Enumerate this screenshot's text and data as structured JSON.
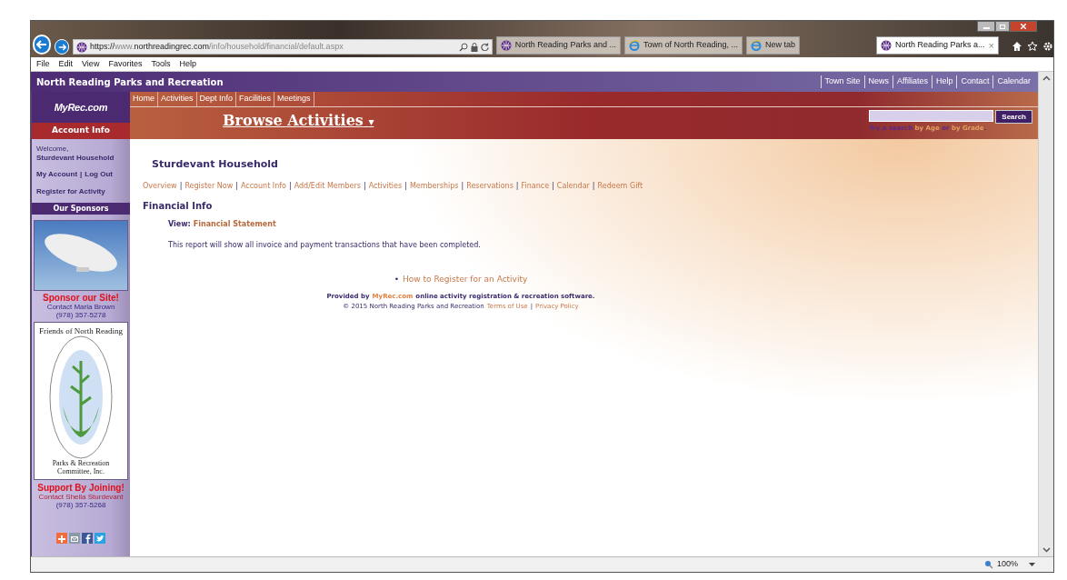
{
  "browser": {
    "address": {
      "scheme": "https://",
      "prefix": "www.",
      "domain": "northreadingrec.com",
      "path": "/info/household/financial/default.aspx"
    },
    "tabs": [
      {
        "title": "North Reading Parks and ...",
        "kind": "site",
        "selected": false
      },
      {
        "title": "Town of North Reading, ...",
        "kind": "ie",
        "selected": false
      },
      {
        "title": "New tab",
        "kind": "ie",
        "selected": false
      },
      {
        "title": "North Reading Parks a...",
        "kind": "site",
        "selected": true
      }
    ],
    "close_glyph": "×",
    "menu": [
      "File",
      "Edit",
      "View",
      "Favorites",
      "Tools",
      "Help"
    ],
    "zoom": "100%"
  },
  "site": {
    "title": "North Reading Parks and Recreation",
    "top_links": [
      "Town Site",
      "News",
      "Affiliates",
      "Help",
      "Contact",
      "Calendar"
    ],
    "nav": [
      "Home",
      "Activities",
      "Dept Info",
      "Facilities",
      "Meetings"
    ],
    "browse": "Browse Activities",
    "browse_caret": "▾",
    "search_button": "Search",
    "search_hint": [
      {
        "text": "Try a search",
        "kind": "plain"
      },
      {
        "text": "by Age",
        "kind": "link"
      },
      {
        "text": "or",
        "kind": "plain"
      },
      {
        "text": "by Grade",
        "kind": "link"
      },
      {
        "text": ".",
        "kind": "plain"
      }
    ]
  },
  "sidebar": {
    "logo": "MyRec.com",
    "account_header": "Account Info",
    "welcome": "Welcome,",
    "household": "Sturdevant Household",
    "account_links": [
      "My Account",
      "Log Out"
    ],
    "separator": "|",
    "register": "Register for Activity",
    "sponsors_header": "Our Sponsors",
    "sponsor_title": "Sponsor our Site!",
    "sponsor_contact": "Contact Maria Brown",
    "sponsor_phone": "(978) 357-5278",
    "logo_top": "Friends of North Reading",
    "logo_bottom": "Parks & Recreation Committee, Inc.",
    "join_title": "Support By Joining!",
    "join_contact": "Contact Sheila Sturdevant",
    "join_phone": "(978) 357-5268",
    "social": [
      {
        "kind": "plus",
        "color": "#f26b3a"
      },
      {
        "kind": "mail",
        "color": "#8a9aa6"
      },
      {
        "kind": "facebook",
        "color": "#3b5998"
      },
      {
        "kind": "twitter",
        "color": "#2aa3e0"
      }
    ]
  },
  "main": {
    "household": "Sturdevant Household",
    "separator": "|",
    "subnav": [
      "Overview",
      "Register Now",
      "Account Info",
      "Add/Edit Members",
      "Activities",
      "Memberships",
      "Reservations",
      "Finance",
      "Calendar",
      "Redeem Gift"
    ],
    "section": "Financial Info",
    "view_label": "View:",
    "view_link": "Financial Statement",
    "note": "This report will show all invoice and payment transactions that have been completed.",
    "bullet": "•",
    "help_link": "How to Register for an Activity",
    "provided_prefix": "Provided by",
    "provided_link": "MyRec.com",
    "provided_suffix": "online activity registration & recreation software.",
    "copyright": "© 2015 North Reading Parks and Recreation",
    "terms": "Terms of Use",
    "privacy": "Privacy Policy"
  }
}
